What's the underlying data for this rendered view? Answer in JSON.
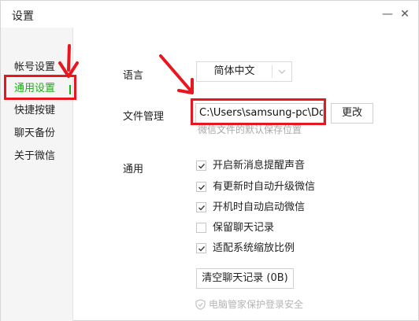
{
  "window": {
    "title": "设置",
    "minimize_symbol": "—",
    "close_symbol": "✕"
  },
  "sidebar": {
    "items": [
      {
        "label": "帐号设置",
        "active": false
      },
      {
        "label": "通用设置",
        "active": true
      },
      {
        "label": "快捷按键",
        "active": false
      },
      {
        "label": "聊天备份",
        "active": false
      },
      {
        "label": "关于微信",
        "active": false
      }
    ]
  },
  "language": {
    "label": "语言",
    "value": "简体中文"
  },
  "file_management": {
    "label": "文件管理",
    "path_value": "C:\\Users\\samsung-pc\\Do",
    "change_button": "更改",
    "hint": "微信文件的默认保存位置"
  },
  "general": {
    "label": "通用",
    "options": [
      {
        "label": "开启新消息提醒声音",
        "checked": true
      },
      {
        "label": "有更新时自动升级微信",
        "checked": true
      },
      {
        "label": "开机时自动启动微信",
        "checked": true
      },
      {
        "label": "保留聊天记录",
        "checked": false
      },
      {
        "label": "适配系统缩放比例",
        "checked": true
      }
    ],
    "clear_button": "清空聊天记录 (0B)"
  },
  "footer": {
    "text": "电脑管家保护登录安全",
    "icon": "shield-check-icon"
  },
  "colors": {
    "accent_green": "#1aad19",
    "annotation_red": "#e8171f",
    "sidebar_bg": "#f5f5f5"
  }
}
